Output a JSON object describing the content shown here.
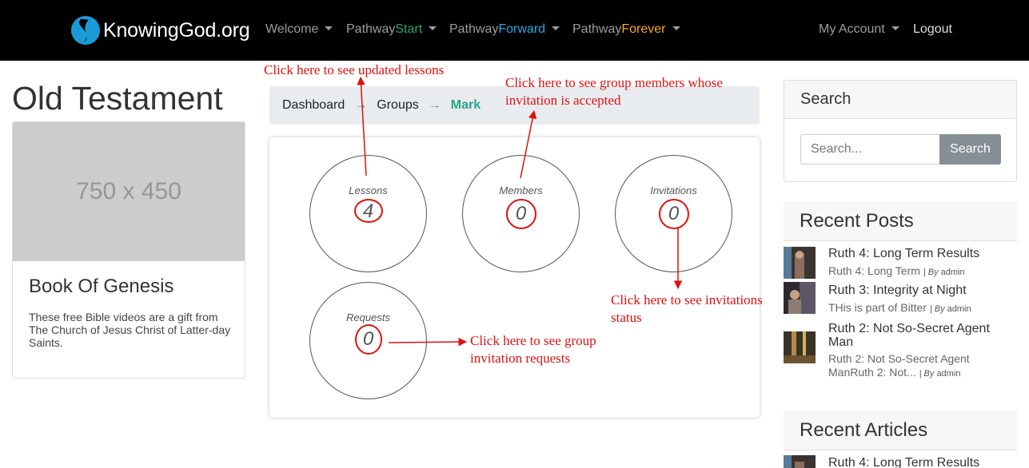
{
  "navbar": {
    "brand": "KnowingGod.org",
    "items": [
      {
        "prefix": "Welcome",
        "suffix": ""
      },
      {
        "prefix": "Pathway",
        "suffix": "Start"
      },
      {
        "prefix": "Pathway",
        "suffix": "Forward"
      },
      {
        "prefix": "Pathway",
        "suffix": "Forever"
      }
    ],
    "my_account": "My Account",
    "logout": "Logout",
    "colors": {
      "start": "#2ea56b",
      "forward": "#2aa8e0",
      "forever": "#f7a823"
    }
  },
  "page": {
    "title": "Old Testament"
  },
  "card": {
    "image_placeholder": "750 x 450",
    "title": "Book Of Genesis",
    "text": "These free Bible videos are a gift from The Church of Jesus Christ of Latter-day Saints."
  },
  "breadcrumb": {
    "dashboard": "Dashboard",
    "groups": "Groups",
    "current": "Mark",
    "separator": "→"
  },
  "group_stats": {
    "lessons": {
      "label": "Lessons",
      "count": "4"
    },
    "members": {
      "label": "Members",
      "count": "0"
    },
    "invitations": {
      "label": "Invitations",
      "count": "0"
    },
    "requests": {
      "label": "Requests",
      "count": "0"
    }
  },
  "annotations": {
    "lessons": "Click here to see updated lessons",
    "members_line1": "Click here to see group members whose",
    "members_line2": "invitation is accepted",
    "invitations_line1": "Click here to see invitations",
    "invitations_line2": "status",
    "requests_line1": "Click here to see group",
    "requests_line2": "invitation requests",
    "color": "#e01010"
  },
  "sidebar": {
    "search": {
      "title": "Search",
      "placeholder": "Search...",
      "button": "Search"
    },
    "recent_posts": {
      "title": "Recent Posts",
      "posts": [
        {
          "title": "Ruth 4: Long Term Results",
          "excerpt": "Ruth 4: Long Term",
          "by": "| By",
          "author": "admin"
        },
        {
          "title": "Ruth 3: Integrity at Night",
          "excerpt": "THis is part of Bitter",
          "by": "| By",
          "author": "admin"
        },
        {
          "title": "Ruth 2: Not So-Secret Agent Man",
          "excerpt1": "Ruth 2: Not So-Secret Agent",
          "excerpt2": "ManRuth 2: Not...",
          "by": "| By",
          "author": "admin"
        }
      ]
    },
    "recent_articles": {
      "title": "Recent Articles",
      "posts": [
        {
          "title": "Ruth 4: Long Term Results"
        }
      ]
    }
  }
}
